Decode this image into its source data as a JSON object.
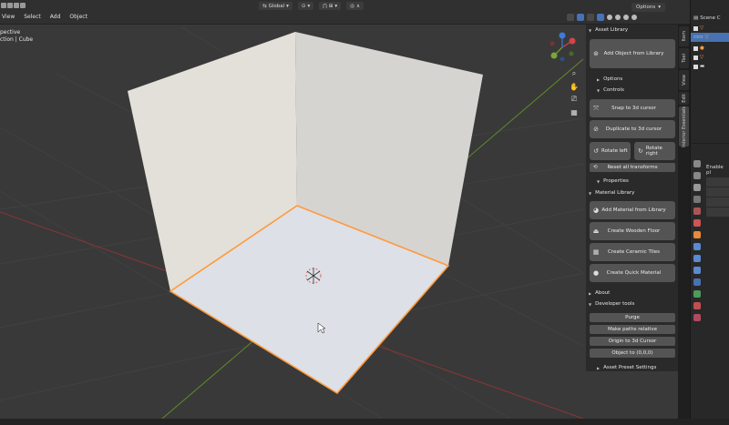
{
  "header": {
    "menu": [
      "View",
      "Select",
      "Add",
      "Object"
    ],
    "orientation_label": "Global",
    "options_label": "Options"
  },
  "viewport": {
    "view_name": "pective",
    "collection_line": "ction | Cube"
  },
  "outliner": {
    "root_label": "Scene C"
  },
  "sidebar": {
    "asset_library": {
      "title": "Asset Library",
      "add_object": "Add Object from Library",
      "options": "Options",
      "controls": "Controls",
      "snap": "Snap to 3d cursor",
      "duplicate": "Duplicate to 3d cursor",
      "rotate_left": "Rotate left",
      "rotate_right": "Rotate right",
      "reset": "Reset all transforms",
      "properties": "Properties"
    },
    "material_library": {
      "title": "Material Library",
      "add_material": "Add Material from Library",
      "wooden_floor": "Create Wooden Floor",
      "ceramic_tiles": "Create Ceramic Tiles",
      "quick_material": "Create Quick Material"
    },
    "about": "About",
    "developer_tools": {
      "title": "Developer tools",
      "purge": "Purge",
      "paths_relative": "Make paths relative",
      "origin_cursor": "Origin to 3d Cursor",
      "object_origin": "Object to (0,0,0)",
      "preset_settings": "Asset Preset Settings"
    }
  },
  "tabs": [
    "Item",
    "Tool",
    "View",
    "Edit",
    "Interior Essentials"
  ],
  "properties": {
    "enable_label": "Enable pl"
  },
  "colors": {
    "selection_outline": "#ff9a3c",
    "x_axis": "#c23a3a",
    "y_axis": "#6f9e2a",
    "button": "#545454",
    "active_tab": "#4772b3"
  }
}
